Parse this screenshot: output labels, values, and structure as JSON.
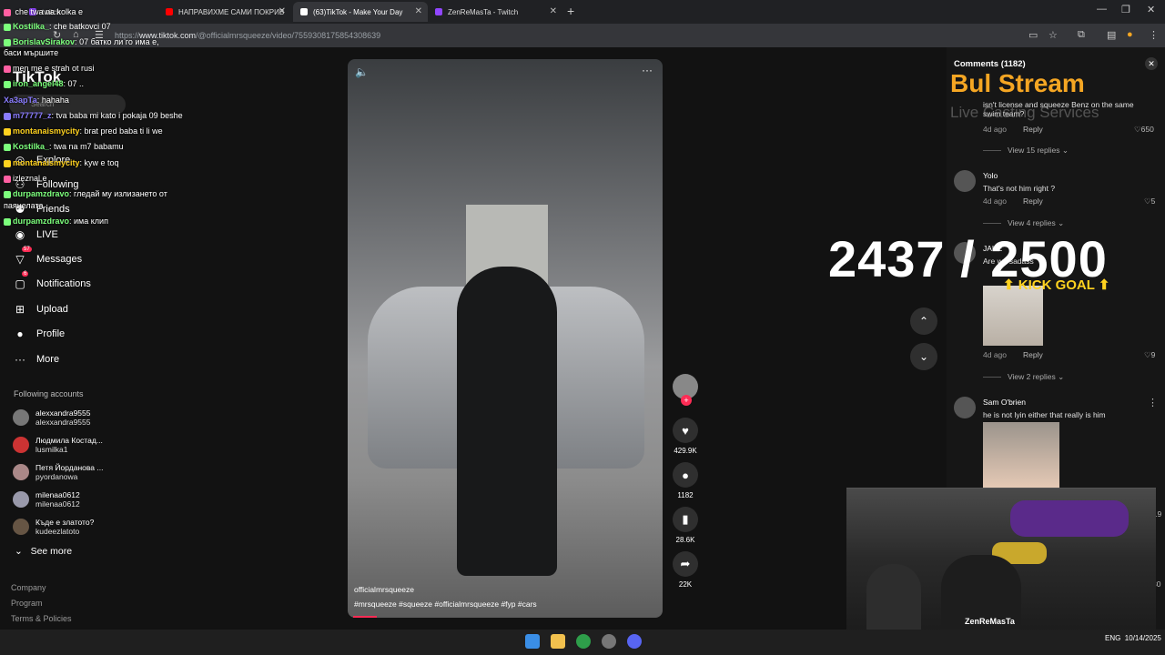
{
  "browser": {
    "tabs": [
      {
        "label": "twitch",
        "color": "#9146ff"
      },
      {
        "label": "НАПРАВИХМЕ САМИ ПОКРИВ",
        "color": "#ff0000"
      },
      {
        "label": "(63)TikTok - Make Your Day",
        "color": "#ffffff"
      },
      {
        "label": "ZenReMasTa - Twitch",
        "color": "#9146ff"
      }
    ],
    "new_tab": "+",
    "url_prefix": "https://",
    "url_domain": "www.tiktok.com",
    "url_path": "/@officialmrsqueeze/video/7559308175854308639"
  },
  "chat": [
    {
      "user": "",
      "text": "che twa na kolka e",
      "color": "#ff5fa2"
    },
    {
      "user": "Kostilka_",
      "text": "che batkovci 07",
      "color": "#7cff7c"
    },
    {
      "user": "BorislavSirakov",
      "text": "07 батко ли го има е,",
      "color": "#7cff7c"
    },
    {
      "user": "",
      "text": "баси мършите",
      "color": "#ffffff"
    },
    {
      "user": "",
      "text": "men me e strah ot rusi",
      "color": "#ff5fa2"
    },
    {
      "user": "iron_angel48",
      "text": "07 ..",
      "color": "#7cff7c"
    },
    {
      "user": "Ха3арТа",
      "text": "hahaha",
      "color": "#8a7cff"
    },
    {
      "user": "m77777_z",
      "text": "tva baba mi kato i pokaja 09 beshe",
      "color": "#8a7cff"
    },
    {
      "user": "montanaismycity",
      "text": "brat pred baba ti li we",
      "color": "#ffd21f"
    },
    {
      "user": "Kostilka_",
      "text": "twa na m7 babamu",
      "color": "#7cff7c"
    },
    {
      "user": "montanaismycity",
      "text": "kyw e toq",
      "color": "#ffd21f"
    },
    {
      "user": "",
      "text": "izleznal e",
      "color": "#ff5fa2"
    },
    {
      "user": "durpamzdravo",
      "text": "гледай му излизането от",
      "color": "#7cff7c"
    },
    {
      "user": "",
      "text": "паянелата",
      "color": "#ffffff"
    },
    {
      "user": "durpamzdravo",
      "text": "има клип",
      "color": "#7cff7c"
    }
  ],
  "tiktok": {
    "logo": "TikTok",
    "search_placeholder": "Search",
    "nav": [
      {
        "label": "Explore",
        "icon": "compass-icon"
      },
      {
        "label": "Following",
        "icon": "following-icon"
      },
      {
        "label": "Friends",
        "icon": "friends-icon"
      },
      {
        "label": "LIVE",
        "icon": "live-icon"
      },
      {
        "label": "Messages",
        "icon": "messages-icon",
        "badge": "57"
      },
      {
        "label": "Notifications",
        "icon": "bell-icon",
        "badge": "6"
      },
      {
        "label": "Upload",
        "icon": "upload-icon"
      },
      {
        "label": "Profile",
        "icon": "profile-icon"
      },
      {
        "label": "More",
        "icon": "more-icon"
      }
    ],
    "following_title": "Following accounts",
    "accounts": [
      {
        "name": "alexxandra9555",
        "handle": "alexxandra9555"
      },
      {
        "name": "Людмила Костад...",
        "handle": "lusmilka1"
      },
      {
        "name": "Петя Йорданова ...",
        "handle": "pyordanowa"
      },
      {
        "name": "milenaa0612",
        "handle": "milenaa0612"
      },
      {
        "name": "Къде е златото?",
        "handle": "kudeezlatoto"
      }
    ],
    "see_more": "See more",
    "footer": [
      "Company",
      "Program",
      "Terms & Policies"
    ]
  },
  "video": {
    "handle": "officialmrsqueeze",
    "tags": "#mrsqueeze #squeeze #officialmrsqueeze #fyp #cars",
    "likes": "429.9K",
    "comments": "1182",
    "saves": "28.6K",
    "shares": "22K",
    "progress": 0.07
  },
  "comments": {
    "title": "Comments (1182)",
    "items": [
      {
        "name": "",
        "text": "isn't license and squeeze Benz on the same swim team?",
        "time": "4d ago",
        "likes": "650",
        "view": "View 15 replies"
      },
      {
        "name": "Yolo",
        "text": "That's not him right ?",
        "time": "4d ago",
        "likes": "5",
        "view": "View 4 replies"
      },
      {
        "name": "JAKE",
        "text": "Are we sadass",
        "time": "4d ago",
        "likes": "9",
        "view": "View 2 replies"
      },
      {
        "name": "Sam O'brien",
        "text": "he is not lyin either that really is him",
        "time": "",
        "likes": "",
        "view": ""
      }
    ],
    "reply_label": "Reply",
    "partial_counts": [
      "019",
      "30"
    ]
  },
  "overlay": {
    "counter": "2437 / 2500",
    "kick_goal": "KICK GOAL",
    "brand": "Bul  Stream",
    "brand_sub": "Live Casting Services",
    "shirt": "ZenReMasTa"
  },
  "taskbar": {
    "lang": "ENG",
    "time": "",
    "date": "10/14/2025"
  }
}
